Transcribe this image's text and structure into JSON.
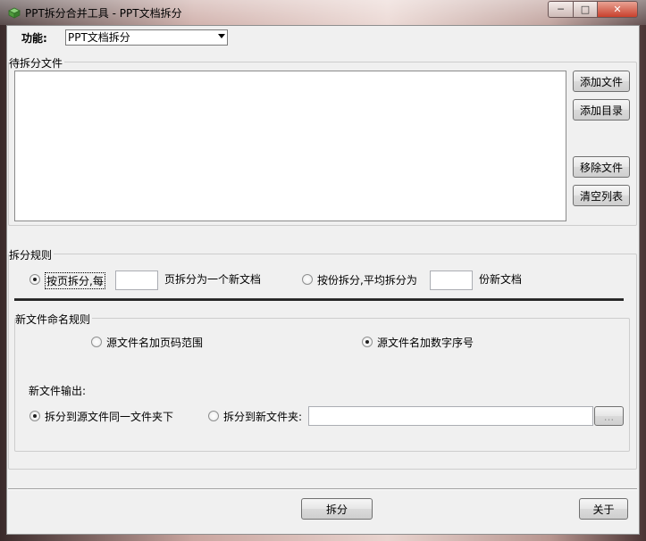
{
  "window": {
    "title": "PPT拆分合并工具 - PPT文档拆分",
    "min_glyph": "─",
    "max_glyph": "□",
    "close_glyph": "✕"
  },
  "function": {
    "label": "功能:",
    "selected": "PPT文档拆分"
  },
  "file_group": {
    "title": "待拆分文件",
    "add_file": "添加文件",
    "add_dir": "添加目录",
    "remove_file": "移除文件",
    "clear_list": "清空列表"
  },
  "split_rule": {
    "title": "拆分规则",
    "by_page_label": "按页拆分,每",
    "by_page_suffix": "页拆分为一个新文档",
    "by_page_value": "",
    "by_copies_label": "按份拆分,平均拆分为",
    "by_copies_suffix": "份新文档",
    "by_copies_value": "",
    "selected": "by_page"
  },
  "naming": {
    "title": "新文件命名规则",
    "page_range": "源文件名加页码范围",
    "seq_number": "源文件名加数字序号",
    "selected": "seq_number"
  },
  "output": {
    "title": "新文件输出:",
    "same_folder": "拆分到源文件同一文件夹下",
    "new_folder": "拆分到新文件夹:",
    "folder_path": "",
    "browse": "...",
    "selected": "same_folder"
  },
  "footer": {
    "split_button": "拆分",
    "about_button": "关于"
  }
}
